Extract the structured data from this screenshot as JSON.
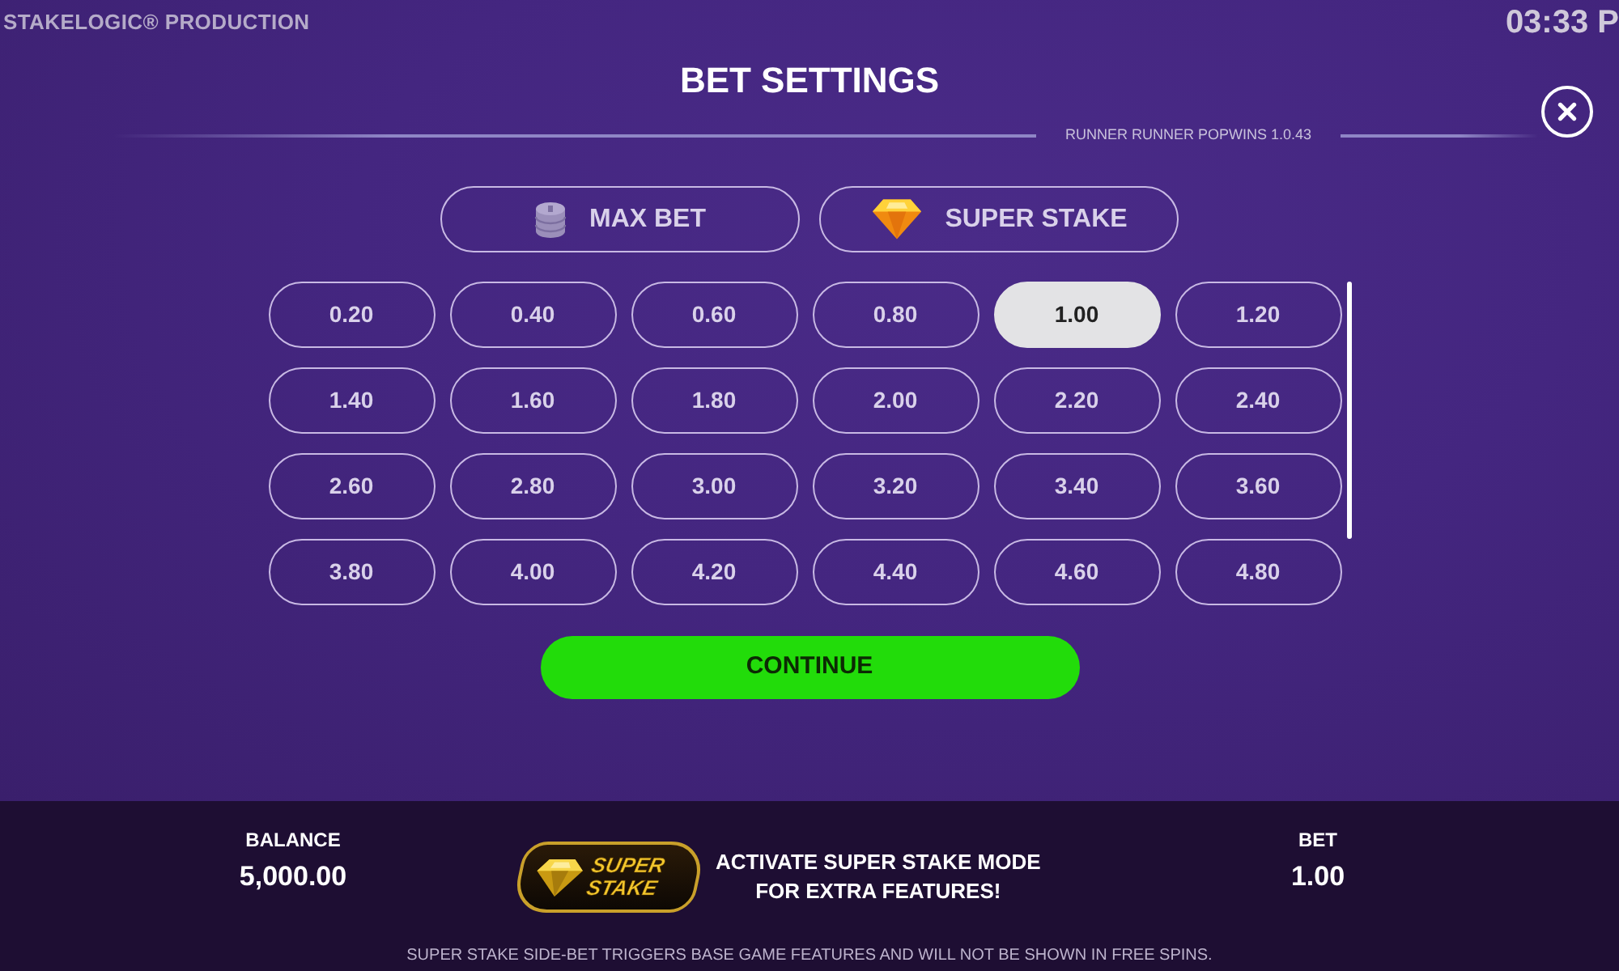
{
  "header": {
    "credit": "STAKELOGIC® PRODUCTION",
    "clock": "03:33 P"
  },
  "dialog": {
    "title": "BET SETTINGS",
    "version": "RUNNER RUNNER POPWINS 1.0.43"
  },
  "options": [
    {
      "kind": "coins",
      "label": "MAX BET"
    },
    {
      "kind": "gem",
      "label": "SUPER STAKE"
    }
  ],
  "bets": [
    {
      "label": "0.20",
      "selected": false
    },
    {
      "label": "0.40",
      "selected": false
    },
    {
      "label": "0.60",
      "selected": false
    },
    {
      "label": "0.80",
      "selected": false
    },
    {
      "label": "1.00",
      "selected": true
    },
    {
      "label": "1.20",
      "selected": false
    },
    {
      "label": "1.40",
      "selected": false
    },
    {
      "label": "1.60",
      "selected": false
    },
    {
      "label": "1.80",
      "selected": false
    },
    {
      "label": "2.00",
      "selected": false
    },
    {
      "label": "2.20",
      "selected": false
    },
    {
      "label": "2.40",
      "selected": false
    },
    {
      "label": "2.60",
      "selected": false
    },
    {
      "label": "2.80",
      "selected": false
    },
    {
      "label": "3.00",
      "selected": false
    },
    {
      "label": "3.20",
      "selected": false
    },
    {
      "label": "3.40",
      "selected": false
    },
    {
      "label": "3.60",
      "selected": false
    },
    {
      "label": "3.80",
      "selected": false
    },
    {
      "label": "4.00",
      "selected": false
    },
    {
      "label": "4.20",
      "selected": false
    },
    {
      "label": "4.40",
      "selected": false
    },
    {
      "label": "4.60",
      "selected": false
    },
    {
      "label": "4.80",
      "selected": false
    }
  ],
  "continue_button": "CONTINUE",
  "info_bar": {
    "balance_label": "BALANCE",
    "balance": "5,000.00",
    "logo_text": "SUPER\nSTAKE",
    "promo": "ACTIVATE SUPER STAKE MODE\nFOR EXTRA FEATURES!",
    "bet_label": "BET",
    "bet": "1.00",
    "disclaimer": "SUPER STAKE SIDE-BET TRIGGERS BASE GAME FEATURES AND WILL NOT BE SHOWN IN FREE SPINS."
  }
}
